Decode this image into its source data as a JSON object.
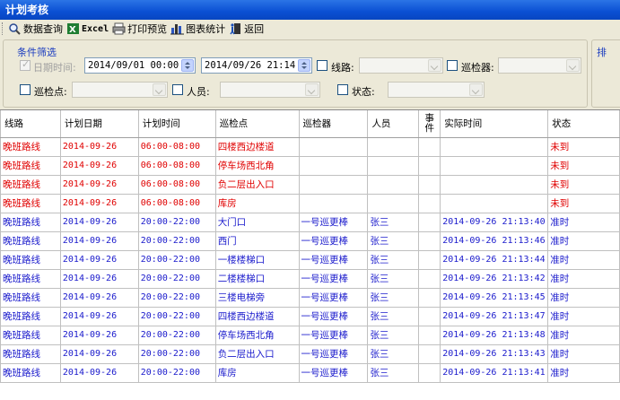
{
  "window": {
    "title": "计划考核"
  },
  "toolbar": {
    "query_label": "数据查询",
    "excel_label": "Excel",
    "print_label": "打印预览",
    "chart_label": "图表统计",
    "back_label": "返回"
  },
  "filter": {
    "legend": "条件筛选",
    "right_legend": "排",
    "date_label": "日期时间:",
    "date_checked": true,
    "date_from": "2014/09/01 00:00",
    "date_to": "2014/09/26 21:14",
    "route_label": "线路:",
    "checker_label": "巡检器:",
    "point_label": "巡检点:",
    "person_label": "人员:",
    "status_label": "状态:"
  },
  "columns": [
    "线路",
    "计划日期",
    "计划时间",
    "巡检点",
    "巡检器",
    "人员",
    "事件",
    "实际时间",
    "状态"
  ],
  "rows": [
    {
      "route": "晚班路线",
      "date": "2014-09-26",
      "time": "06:00-08:00",
      "point": "四楼西边楼道",
      "checker": "",
      "person": "",
      "event": "",
      "actual": "",
      "status": "未到",
      "kind": "late"
    },
    {
      "route": "晚班路线",
      "date": "2014-09-26",
      "time": "06:00-08:00",
      "point": "停车场西北角",
      "checker": "",
      "person": "",
      "event": "",
      "actual": "",
      "status": "未到",
      "kind": "late"
    },
    {
      "route": "晚班路线",
      "date": "2014-09-26",
      "time": "06:00-08:00",
      "point": "负二层出入口",
      "checker": "",
      "person": "",
      "event": "",
      "actual": "",
      "status": "未到",
      "kind": "late"
    },
    {
      "route": "晚班路线",
      "date": "2014-09-26",
      "time": "06:00-08:00",
      "point": "库房",
      "checker": "",
      "person": "",
      "event": "",
      "actual": "",
      "status": "未到",
      "kind": "late"
    },
    {
      "route": "晚班路线",
      "date": "2014-09-26",
      "time": "20:00-22:00",
      "point": "大门口",
      "checker": "一号巡更棒",
      "person": "张三",
      "event": "",
      "actual": "2014-09-26 21:13:40",
      "status": "准时",
      "kind": "ontime"
    },
    {
      "route": "晚班路线",
      "date": "2014-09-26",
      "time": "20:00-22:00",
      "point": "西门",
      "checker": "一号巡更棒",
      "person": "张三",
      "event": "",
      "actual": "2014-09-26 21:13:46",
      "status": "准时",
      "kind": "ontime"
    },
    {
      "route": "晚班路线",
      "date": "2014-09-26",
      "time": "20:00-22:00",
      "point": "一楼楼梯口",
      "checker": "一号巡更棒",
      "person": "张三",
      "event": "",
      "actual": "2014-09-26 21:13:44",
      "status": "准时",
      "kind": "ontime"
    },
    {
      "route": "晚班路线",
      "date": "2014-09-26",
      "time": "20:00-22:00",
      "point": "二楼楼梯口",
      "checker": "一号巡更棒",
      "person": "张三",
      "event": "",
      "actual": "2014-09-26 21:13:42",
      "status": "准时",
      "kind": "ontime"
    },
    {
      "route": "晚班路线",
      "date": "2014-09-26",
      "time": "20:00-22:00",
      "point": "三楼电梯旁",
      "checker": "一号巡更棒",
      "person": "张三",
      "event": "",
      "actual": "2014-09-26 21:13:45",
      "status": "准时",
      "kind": "ontime"
    },
    {
      "route": "晚班路线",
      "date": "2014-09-26",
      "time": "20:00-22:00",
      "point": "四楼西边楼道",
      "checker": "一号巡更棒",
      "person": "张三",
      "event": "",
      "actual": "2014-09-26 21:13:47",
      "status": "准时",
      "kind": "ontime"
    },
    {
      "route": "晚班路线",
      "date": "2014-09-26",
      "time": "20:00-22:00",
      "point": "停车场西北角",
      "checker": "一号巡更棒",
      "person": "张三",
      "event": "",
      "actual": "2014-09-26 21:13:48",
      "status": "准时",
      "kind": "ontime"
    },
    {
      "route": "晚班路线",
      "date": "2014-09-26",
      "time": "20:00-22:00",
      "point": "负二层出入口",
      "checker": "一号巡更棒",
      "person": "张三",
      "event": "",
      "actual": "2014-09-26 21:13:43",
      "status": "准时",
      "kind": "ontime"
    },
    {
      "route": "晚班路线",
      "date": "2014-09-26",
      "time": "20:00-22:00",
      "point": "库房",
      "checker": "一号巡更棒",
      "person": "张三",
      "event": "",
      "actual": "2014-09-26 21:13:41",
      "status": "准时",
      "kind": "ontime"
    }
  ],
  "colors": {
    "late": "#e00000",
    "ontime": "#1a1acc",
    "title_bar": "#0a4fd3"
  }
}
